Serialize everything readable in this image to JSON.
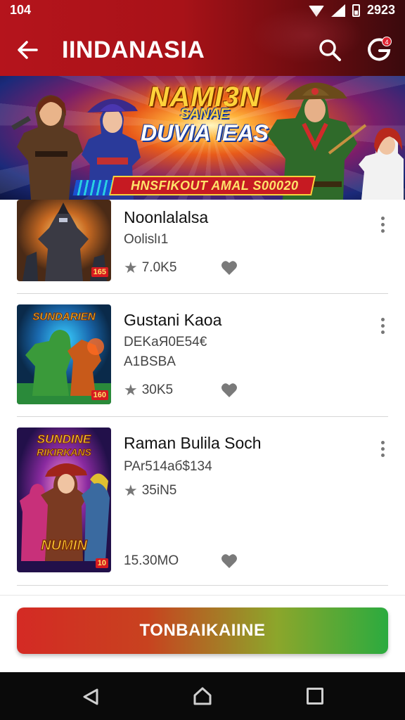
{
  "status_bar": {
    "time": "104",
    "right_text": "2923"
  },
  "header": {
    "title": "IINDANASIA",
    "notification_count": "4"
  },
  "banner": {
    "title_line1": "NAMI3N",
    "title_line1b": "SANAE",
    "title_line2": "DUVIA IEAS",
    "strip_text": "HNSFIKOUT AMAL S00020"
  },
  "items": [
    {
      "title": "Noonlalalsa",
      "subtitle": "Oolislı1",
      "subtitle2": "",
      "rating": "7.0K5",
      "price_badge": "165"
    },
    {
      "title": "Gustani Kaoa",
      "subtitle": "DEKaЯ0E54€",
      "subtitle2": "A1BSBA",
      "rating": "30K5",
      "price_badge": "160"
    },
    {
      "title": "Raman Bulila Soch",
      "subtitle": "PAr514aб$134",
      "subtitle2": "",
      "rating": "35iN5",
      "footer_value": "15.30MO",
      "price_badge": "10"
    }
  ],
  "cta": {
    "label": "TONBAIKAIINE"
  },
  "colors": {
    "header_red": "#b5141c",
    "cta_start": "#d42a24",
    "cta_end": "#2bab3f"
  }
}
